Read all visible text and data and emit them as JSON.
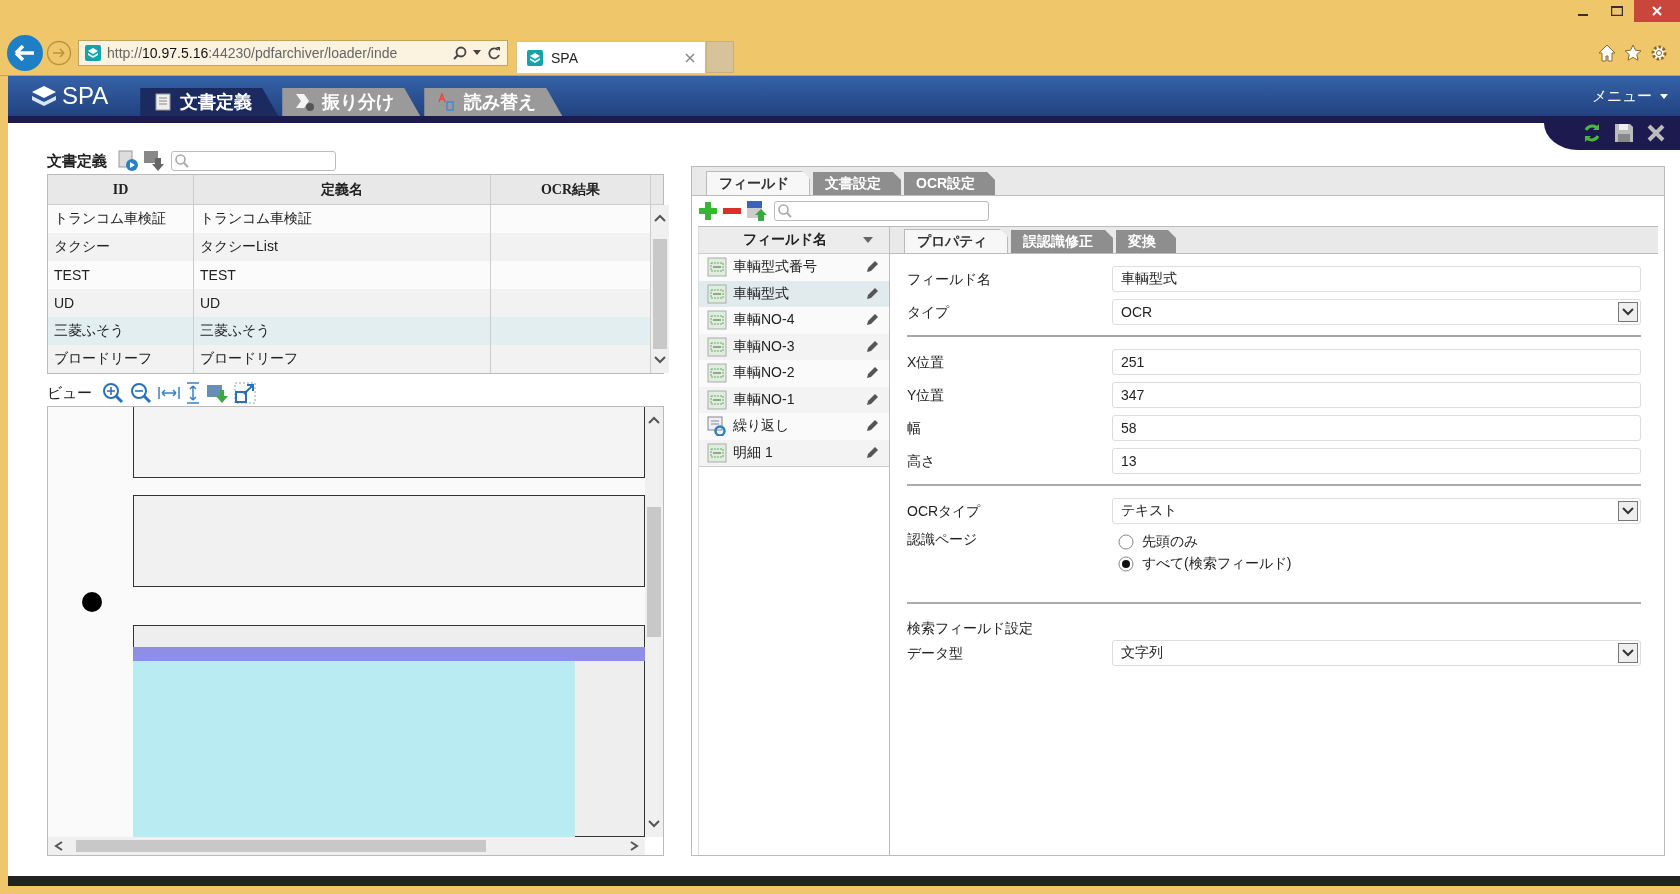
{
  "browser": {
    "address": {
      "scheme": "http://",
      "host": "10.97.5.16",
      "rest": ":44230/pdfarchiver/loader/inde"
    },
    "tab": {
      "title": "SPA"
    }
  },
  "app": {
    "logo": "SPA",
    "tabs": [
      {
        "label": "文書定義",
        "selected": true
      },
      {
        "label": "振り分け",
        "selected": false
      },
      {
        "label": "読み替え",
        "selected": false
      }
    ],
    "menu": "メニュー"
  },
  "documents": {
    "title": "文書定義",
    "table": {
      "columns": [
        "ID",
        "定義名",
        "OCR結果"
      ],
      "rows": [
        {
          "cells": [
            "トランコム車検証",
            "トランコム車検証",
            ""
          ],
          "selected": false
        },
        {
          "cells": [
            "タクシー",
            "タクシーList",
            ""
          ],
          "selected": false
        },
        {
          "cells": [
            "TEST",
            "TEST",
            ""
          ],
          "selected": false
        },
        {
          "cells": [
            "UD",
            "UD",
            ""
          ],
          "selected": false
        },
        {
          "cells": [
            "三菱ふそう",
            "三菱ふそう",
            ""
          ],
          "selected": true
        },
        {
          "cells": [
            "ブロードリーフ",
            "ブロードリーフ",
            ""
          ],
          "selected": false
        }
      ]
    }
  },
  "view": {
    "title": "ビュー"
  },
  "fields_panel": {
    "tabs": [
      {
        "label": "フィールド",
        "selected": true
      },
      {
        "label": "文書設定",
        "selected": false
      },
      {
        "label": "OCR設定",
        "selected": false
      }
    ],
    "list_header": "フィールド名",
    "fields": [
      {
        "name": "車輌型式番号",
        "kind": "text",
        "selected": false
      },
      {
        "name": "車輌型式",
        "kind": "text",
        "selected": true
      },
      {
        "name": "車輌NO-4",
        "kind": "text",
        "selected": false
      },
      {
        "name": "車輌NO-3",
        "kind": "text",
        "selected": false
      },
      {
        "name": "車輌NO-2",
        "kind": "text",
        "selected": false
      },
      {
        "name": "車輌NO-1",
        "kind": "text",
        "selected": false
      },
      {
        "name": "繰り返し",
        "kind": "repeat",
        "selected": false
      },
      {
        "name": "明細 1",
        "kind": "text",
        "selected": false
      }
    ],
    "property_tabs": [
      {
        "label": "プロパティ",
        "selected": true
      },
      {
        "label": "誤認識修正",
        "selected": false
      },
      {
        "label": "変換",
        "selected": false
      }
    ],
    "properties": [
      {
        "kind": "input",
        "label": "フィールド名",
        "value": "車輌型式"
      },
      {
        "kind": "select",
        "label": "タイプ",
        "value": "OCR"
      },
      {
        "kind": "divider"
      },
      {
        "kind": "input",
        "label": "X位置",
        "value": "251"
      },
      {
        "kind": "input",
        "label": "Y位置",
        "value": "347"
      },
      {
        "kind": "input",
        "label": "幅",
        "value": "58"
      },
      {
        "kind": "input",
        "label": "高さ",
        "value": "13"
      },
      {
        "kind": "divider"
      },
      {
        "kind": "select",
        "label": "OCRタイプ",
        "value": "テキスト"
      },
      {
        "kind": "radio",
        "label": "認識ページ",
        "options": [
          {
            "label": "先頭のみ",
            "selected": false
          },
          {
            "label": "すべて(検索フィールド)",
            "selected": true
          }
        ]
      },
      {
        "kind": "divider"
      },
      {
        "kind": "heading",
        "label": "検索フィールド設定"
      },
      {
        "kind": "select",
        "label": "データ型",
        "value": "文字列"
      }
    ]
  }
}
